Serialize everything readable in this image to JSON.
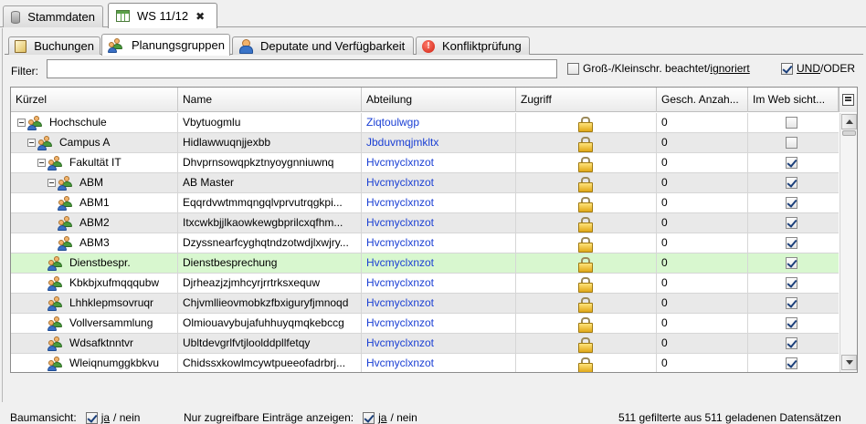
{
  "top_tabs": [
    {
      "label": "Stammdaten",
      "icon": "database-icon",
      "active": false
    },
    {
      "label": "WS 11/12",
      "icon": "grid-icon",
      "active": true,
      "close": "✖"
    }
  ],
  "sub_tabs": [
    {
      "label": "Buchungen",
      "icon": "book-icon"
    },
    {
      "label": "Planungsgruppen",
      "icon": "group-icon"
    },
    {
      "label": "Deputate und Verfügbarkeit",
      "icon": "person-icon"
    },
    {
      "label": "Konfliktprüfung",
      "icon": "warning-icon",
      "glyph": "!"
    }
  ],
  "filter": {
    "label": "Filter:",
    "value": "",
    "case_label_a": "Groß-/Kleinschr. beachtet/",
    "case_label_b": "ignoriert",
    "case_checked": false,
    "und_label": "UND",
    "oder_label": "/ODER",
    "und_checked": true
  },
  "table": {
    "columns": [
      "Kürzel",
      "Name",
      "Abteilung",
      "Zugriff",
      "Gesch. Anzah...",
      "Im Web sicht..."
    ],
    "rows": [
      {
        "kuerzel": "Hochschule",
        "name": "Vbytuogmlu",
        "abteilung": "Ziqtoulwgp",
        "anzahl": "0",
        "web": false
      },
      {
        "kuerzel": "Campus A",
        "name": "Hidlawwuqnjjexbb",
        "abteilung": "Jbduvmqjmkltx",
        "anzahl": "0",
        "web": false
      },
      {
        "kuerzel": "Fakultät IT",
        "name": "Dhvprnsowqpkztnyoygnniuwnq",
        "abteilung": "Hvcmyclxnzot",
        "anzahl": "0",
        "web": true
      },
      {
        "kuerzel": "ABM",
        "name": "AB Master",
        "abteilung": "Hvcmyclxnzot",
        "anzahl": "0",
        "web": true
      },
      {
        "kuerzel": "ABM1",
        "name": "Eqqrdvwtmmqngqlvprvutrqgkpi...",
        "abteilung": "Hvcmyclxnzot",
        "anzahl": "0",
        "web": true
      },
      {
        "kuerzel": "ABM2",
        "name": "Itxcwkbjjlkaowkewgbprilcxqfhm...",
        "abteilung": "Hvcmyclxnzot",
        "anzahl": "0",
        "web": true
      },
      {
        "kuerzel": "ABM3",
        "name": "Dzyssnearfcyghqtndzotwdjlxwjry...",
        "abteilung": "Hvcmyclxnzot",
        "anzahl": "0",
        "web": true
      },
      {
        "kuerzel": "Dienstbespr.",
        "name": "Dienstbesprechung",
        "abteilung": "Hvcmyclxnzot",
        "anzahl": "0",
        "web": true
      },
      {
        "kuerzel": "Kbkbjxufmqqqubw",
        "name": "Djrheazjzjmhcyrjrrtrksxequw",
        "abteilung": "Hvcmyclxnzot",
        "anzahl": "0",
        "web": true
      },
      {
        "kuerzel": "Lhhklepmsovruqr",
        "name": "Chjvmllieovmobkzfbxiguryfjmnoqd",
        "abteilung": "Hvcmyclxnzot",
        "anzahl": "0",
        "web": true
      },
      {
        "kuerzel": "Vollversammlung",
        "name": "Olmiouavybujafuhhuyqmqkebccg",
        "abteilung": "Hvcmyclxnzot",
        "anzahl": "0",
        "web": true
      },
      {
        "kuerzel": "Wdsafktnntvr",
        "name": "Ubltdevgrlfvtjloolddpllfetqy",
        "abteilung": "Hvcmyclxnzot",
        "anzahl": "0",
        "web": true
      },
      {
        "kuerzel": "Wleiqnumggkbkvu",
        "name": "Chidssxkowlmcywtpueeofadrbrj...",
        "abteilung": "Hvcmyclxnzot",
        "anzahl": "0",
        "web": true
      }
    ]
  },
  "footer": {
    "tree_label": "Baumansicht:",
    "tree_checked": true,
    "ja": "ja",
    "nein": "/ nein",
    "access_label": "Nur zugreifbare Einträge anzeigen:",
    "access_checked": true,
    "count_text": "511 gefilterte aus 511 geladenen Datensätzen"
  },
  "colors": {
    "selected_row": "#d8f7cf",
    "link": "#1a3fd4",
    "alt_row": "#e9e9e9"
  }
}
